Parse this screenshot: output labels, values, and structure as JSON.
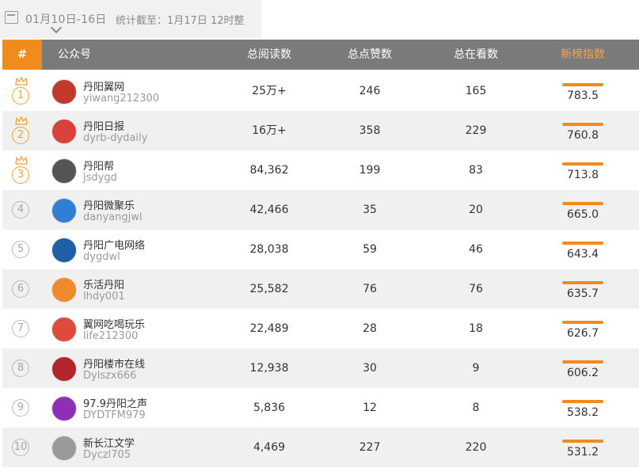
{
  "toolbar": {
    "date_range": "01月10日-16日",
    "stat_time": "统计截至：1月17日 12时整"
  },
  "table": {
    "headers": {
      "rank": "#",
      "account": "公众号",
      "reads": "总阅读数",
      "likes": "总点赞数",
      "looking": "总在看数",
      "index": "新榜指数"
    },
    "rows": [
      {
        "rank": "1",
        "name": "丹阳翼网",
        "id": "yiwang212300",
        "reads": "25万+",
        "likes": "246",
        "looking": "165",
        "index": "783.5",
        "avatar_color": "#c0392b"
      },
      {
        "rank": "2",
        "name": "丹阳日报",
        "id": "dyrb-dydaily",
        "reads": "16万+",
        "likes": "358",
        "looking": "229",
        "index": "760.8",
        "avatar_color": "#d9413a"
      },
      {
        "rank": "3",
        "name": "丹阳帮",
        "id": "jsdygd",
        "reads": "84,362",
        "likes": "199",
        "looking": "83",
        "index": "713.8",
        "avatar_color": "#555555"
      },
      {
        "rank": "4",
        "name": "丹阳微聚乐",
        "id": "danyangjwl",
        "reads": "42,466",
        "likes": "35",
        "looking": "20",
        "index": "665.0",
        "avatar_color": "#2f7fd6"
      },
      {
        "rank": "5",
        "name": "丹阳广电网络",
        "id": "dygdwl",
        "reads": "28,038",
        "likes": "59",
        "looking": "46",
        "index": "643.4",
        "avatar_color": "#1f5fa8"
      },
      {
        "rank": "6",
        "name": "乐活丹阳",
        "id": "lhdy001",
        "reads": "25,582",
        "likes": "76",
        "looking": "76",
        "index": "635.7",
        "avatar_color": "#f0882e"
      },
      {
        "rank": "7",
        "name": "翼网吃喝玩乐",
        "id": "life212300",
        "reads": "22,489",
        "likes": "28",
        "looking": "18",
        "index": "626.7",
        "avatar_color": "#e04a3c"
      },
      {
        "rank": "8",
        "name": "丹阳楼市在线",
        "id": "Dylszx666",
        "reads": "12,938",
        "likes": "30",
        "looking": "9",
        "index": "606.2",
        "avatar_color": "#b3262b"
      },
      {
        "rank": "9",
        "name": "97.9丹阳之声",
        "id": "DYDTFM979",
        "reads": "5,836",
        "likes": "12",
        "looking": "8",
        "index": "538.2",
        "avatar_color": "#8e2fb8"
      },
      {
        "rank": "10",
        "name": "新长江文学",
        "id": "Dyczl705",
        "reads": "4,469",
        "likes": "227",
        "looking": "220",
        "index": "531.2",
        "avatar_color": "#9a9a9a"
      }
    ]
  },
  "colors": {
    "accent": "#f08c1e",
    "header_bg": "#7a7a7a",
    "alt_row": "#f0f0f0",
    "gold": "#f0a040"
  }
}
